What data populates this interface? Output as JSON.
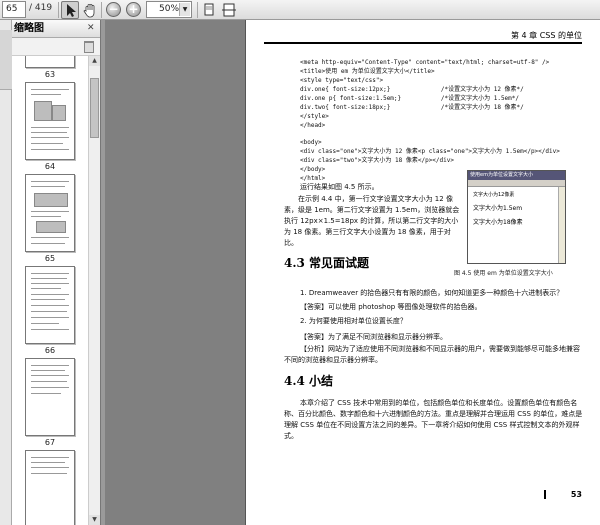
{
  "toolbar": {
    "page_current": "65",
    "page_total": "/ 419",
    "zoom_value": "50%"
  },
  "panel": {
    "title": "缩略图",
    "thumbnail_labels": [
      "63",
      "64",
      "65",
      "66",
      "67"
    ]
  },
  "document": {
    "header_text": "第 4 章   CSS 的单位",
    "code_block_1": "<meta http-equiv=\"Content-Type\" content=\"text/html; charset=utf-8\" />\n<title>使用 em 为单位设置文字大小</title>\n<style type=\"text/css\">\ndiv.one{ font-size:12px;}              /*设置文字大小为 12 像素*/\ndiv.one p{ font-size:1.5em;}           /*设置文字大小为 1.5em*/\ndiv.two{ font-size:18px;}              /*设置文字大小为 18 像素*/\n</style>\n</head>",
    "code_block_2": "<body>\n<div class=\"one\">文字大小为 12 像素<p class=\"one\">文字大小为 1.5em</p></div>\n<div class=\"two\">文字大小为 18 像素</p></div>\n</body>\n</html>",
    "run_result_line": "运行结果如图 4.5 所示。",
    "explanation": "在示例 4.4 中，第一行文字设置文字大小为 12 像素，级是 1em。第二行文字设置为 1.5em，浏览器就会执行 12px×1.5=18px 的计算，所以第二行文字的大小为 18 像素。第三行文字大小设置为 18 像素，用于对比。",
    "browser_title": "使用em为单位设置文字大小",
    "browser_lines": [
      "文字大小为12像素",
      "文字大小为1.5em",
      "文字大小为18像素"
    ],
    "figure_caption": "图 4.5   使用 em 为单位设置文字大小",
    "section_faq_title": "4.3   常见面试题",
    "q1": "1. Dreamweaver 的拾色器只有有限的颜色，如何知道更多一种颜色十六进制表示？",
    "a1": "【答案】可以使用 photoshop 等图像处理软件的拾色器。",
    "q2": "2. 为何要使用相对单位设置长度？",
    "a2": "【答案】为了满足不同浏览器和显示器分辨率。",
    "a2_analysis": "【分析】网站为了适应使用不同浏览器和不同显示器的用户，需要做到能够尽可能多地兼容不同的浏览器和显示器分辨率。",
    "section_summary_title": "4.4   小结",
    "summary": "本章介绍了 CSS 技术中常用到的单位，包括颜色单位和长度单位。设置颜色单位有颜色名称、百分比颜色、数字颜色和十六进制颜色的方法。重点是理解并合理运用 CSS 的单位，难点是理解 CSS 单位在不同设置方法之间的差异。下一章将介绍如何使用 CSS 样式控制文本的外观样式。",
    "page_number": "53"
  }
}
